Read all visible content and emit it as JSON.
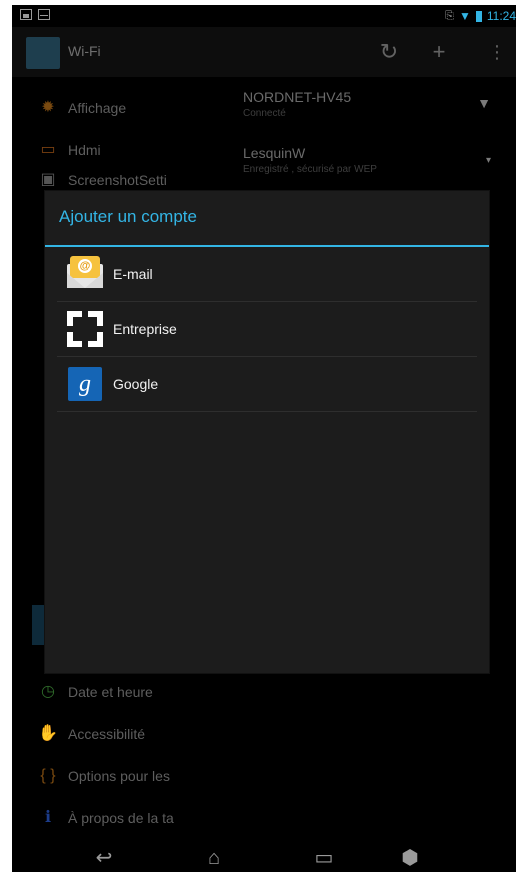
{
  "status_bar": {
    "clock": "11:24",
    "icons": [
      "image-notification-icon",
      "mail-notification-icon",
      "bluetooth-icon",
      "wifi-icon",
      "battery-icon"
    ]
  },
  "action_bar": {
    "title": "Wi-Fi",
    "icons": [
      "wifi-settings-app-icon",
      "wps-icon",
      "add-network-icon",
      "overflow-menu-icon"
    ]
  },
  "settings_list": {
    "items": [
      {
        "label": "Affichage",
        "icon": "display-icon"
      },
      {
        "label": "Hdmi",
        "icon": "hdmi-icon"
      },
      {
        "label": "ScreenshotSetti",
        "icon": "screenshot-icon"
      },
      {
        "label": "Date et heure",
        "icon": "clock-icon"
      },
      {
        "label": "Accessibilité",
        "icon": "hand-icon"
      },
      {
        "label": "Options pour les",
        "icon": "developer-options-icon"
      },
      {
        "label": "À propos de la ta",
        "icon": "info-icon"
      }
    ]
  },
  "wifi_networks": [
    {
      "name": "NORDNET-HV45",
      "status": "Connecté"
    },
    {
      "name": "LesquinW",
      "status": "Enregistré , sécurisé par WEP"
    }
  ],
  "dialog": {
    "title": "Ajouter un compte",
    "options": [
      {
        "label": "E-mail",
        "icon": "email-icon"
      },
      {
        "label": "Entreprise",
        "icon": "enterprise-icon"
      },
      {
        "label": "Google",
        "icon": "google-icon"
      }
    ]
  },
  "nav_bar": {
    "buttons": [
      "back-button",
      "home-button",
      "recent-apps-button",
      "game-controller-button"
    ]
  },
  "colors": {
    "accent": "#33b5e5",
    "dialog_background": "#1c1c1c",
    "screen_background": "#000000"
  }
}
